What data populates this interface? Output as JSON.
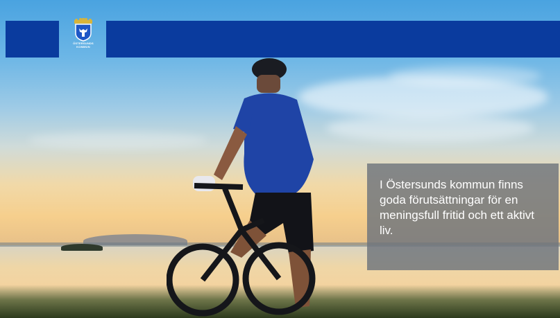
{
  "logo": {
    "line1": "ÖSTERSUNDS",
    "line2": "KOMMUN"
  },
  "info_box": {
    "text": "I Östersunds kommun finns goda förutsättningar för en meningsfull fritid och ett aktivt liv."
  },
  "colors": {
    "header_blue": "#0a3b9e",
    "info_box_bg": "#6e747c",
    "info_text": "#ffffff"
  },
  "icons": {
    "logo": "coat-of-arms-icon"
  }
}
